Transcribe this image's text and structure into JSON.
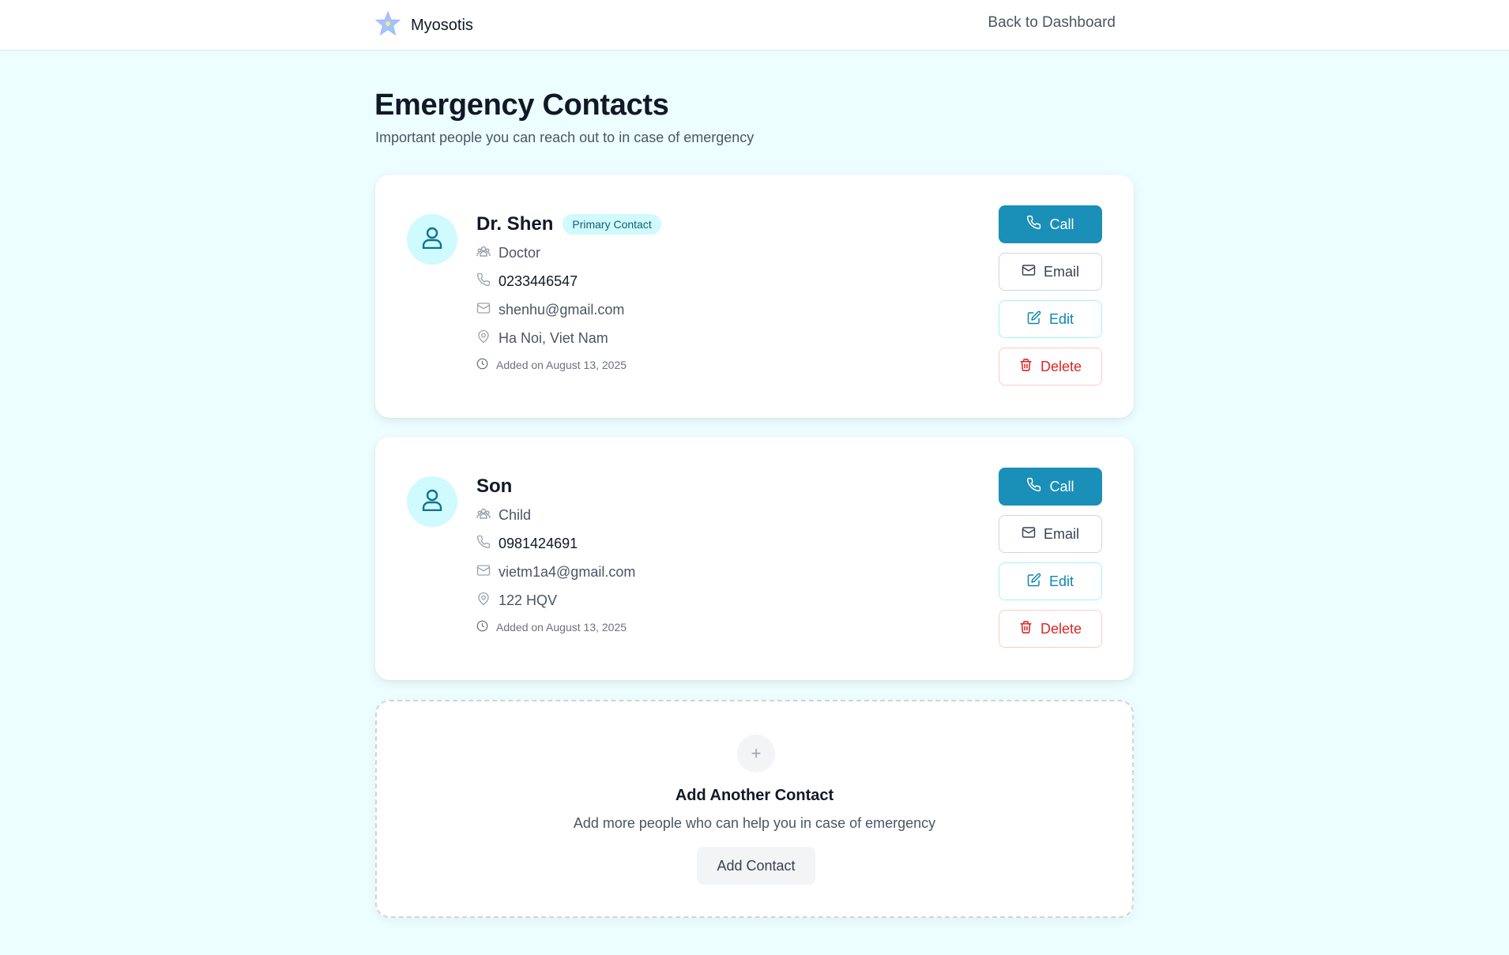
{
  "header": {
    "brand": "Myosotis",
    "back_link": "Back to Dashboard"
  },
  "page": {
    "title": "Emergency Contacts",
    "subtitle": "Important people you can reach out to in case of emergency"
  },
  "contacts": [
    {
      "name": "Dr. Shen",
      "badge": "Primary Contact",
      "relationship": "Doctor",
      "phone": "0233446547",
      "email": "shenhu@gmail.com",
      "address": "Ha Noi, Viet Nam",
      "added": "Added on August 13, 2025"
    },
    {
      "name": "Son",
      "relationship": "Child",
      "phone": "0981424691",
      "email": "vietm1a4@gmail.com",
      "address": "122 HQV",
      "added": "Added on August 13, 2025"
    }
  ],
  "actions": {
    "call": "Call",
    "email": "Email",
    "edit": "Edit",
    "delete": "Delete"
  },
  "add_section": {
    "plus": "+",
    "title": "Add Another Contact",
    "subtitle": "Add more people who can help you in case of emergency",
    "button": "Add Contact"
  },
  "colors": {
    "background": "#ecfeff",
    "accent": "#1a8fb7",
    "danger": "#dc2626",
    "badge_bg": "#cffafe"
  }
}
